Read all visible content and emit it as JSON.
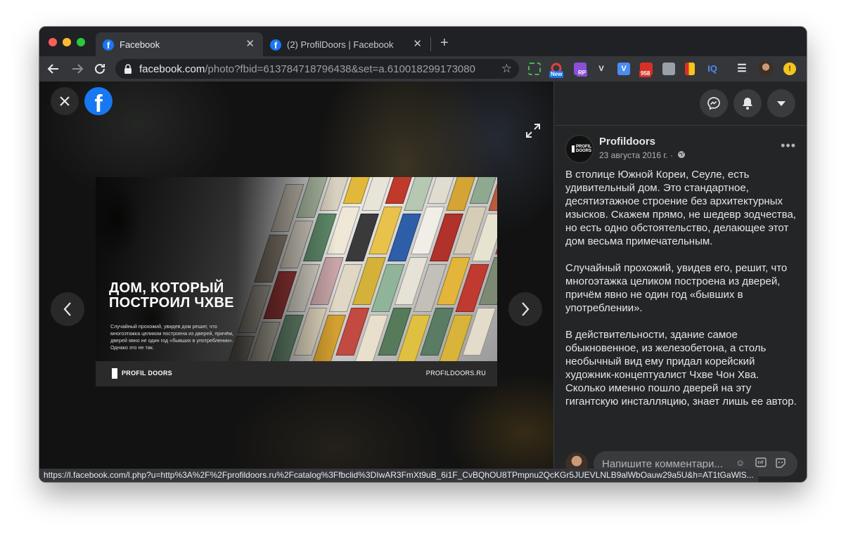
{
  "tabs": [
    {
      "title": "Facebook",
      "active": true
    },
    {
      "title": "(2) ProfilDoors | Facebook",
      "active": false
    }
  ],
  "address_bar": {
    "host": "facebook.com",
    "path": "/photo?fbid=613784718796438&set=a.610018299173080"
  },
  "extensions": [
    {
      "name": "green-dashed-extension-icon",
      "color": "#3fb950",
      "label": ""
    },
    {
      "name": "ring-extension-icon",
      "color": "#e04040",
      "label": "",
      "badge": "New",
      "badge_color": "#1a73e8"
    },
    {
      "name": "rp-extension-icon",
      "color": "#8b4fd6",
      "label": "",
      "badge": "RP",
      "badge_color": "#8b4fd6"
    },
    {
      "name": "v-extension-icon",
      "color": "#35363a",
      "label": "V"
    },
    {
      "name": "v-blue-extension-icon",
      "color": "#4a8cf0",
      "label": "V"
    },
    {
      "name": "mail-extension-icon",
      "color": "#d93025",
      "label": "",
      "badge": "958",
      "badge_color": "#d93025"
    },
    {
      "name": "briefcase-extension-icon",
      "color": "#9aa0a6",
      "label": ""
    },
    {
      "name": "flag-extension-icon",
      "color": "#f5c518",
      "label": ""
    },
    {
      "name": "iq-extension-icon",
      "color": "#35363a",
      "label": "IQ"
    }
  ],
  "photo": {
    "headline": "ДОМ, КОТОРЫЙ ПОСТРОИЛ ЧХВЕ",
    "subtext": "Случайный прохожий, увидев дом решит, что многоэтажка целиком построена из дверей, причём, дверей явно не один год «бывших в употреблении». Однако это не так.",
    "brand": "PROFIL DOORS",
    "site": "PROFILDOORS.RU"
  },
  "post": {
    "author": "Profildoors",
    "date": "23 августа 2016 г. ·",
    "avatar_text": "PROFIL DOORS",
    "paragraphs": [
      "В столице Южной Кореи, Сеуле, есть удивительный дом. Это стандартное, десятиэтажное строение без архитектурных изысков. Скажем прямо, не шедевр зодчества, но есть одно обстоятельство, делающее этот дом весьма примечательным.",
      "Случайный прохожий, увидев его, решит, что многоэтажка целиком построена из дверей, причём явно не один год «бывших в употреблении».",
      "В действительности, здание самое обыкновенное, из железобетона, а столь необычный вид ему придал корейский художник-концептуалист Чхве Чон Хва. Сколько именно пошло дверей на эту гигантскую инсталляцию, знает лишь ее автор."
    ]
  },
  "comment": {
    "placeholder": "Напишите комментари..."
  },
  "status_url": "https://l.facebook.com/l.php?u=http%3A%2F%2Fprofildoors.ru%2Fcatalog%3Ffbclid%3DIwAR3FmXt9uB_6i1F_CvBQhOU8TPmpnu2QcKGr5JUEVLNLB9alWbOauw29a5U&h=AT1tGaWlS..."
}
